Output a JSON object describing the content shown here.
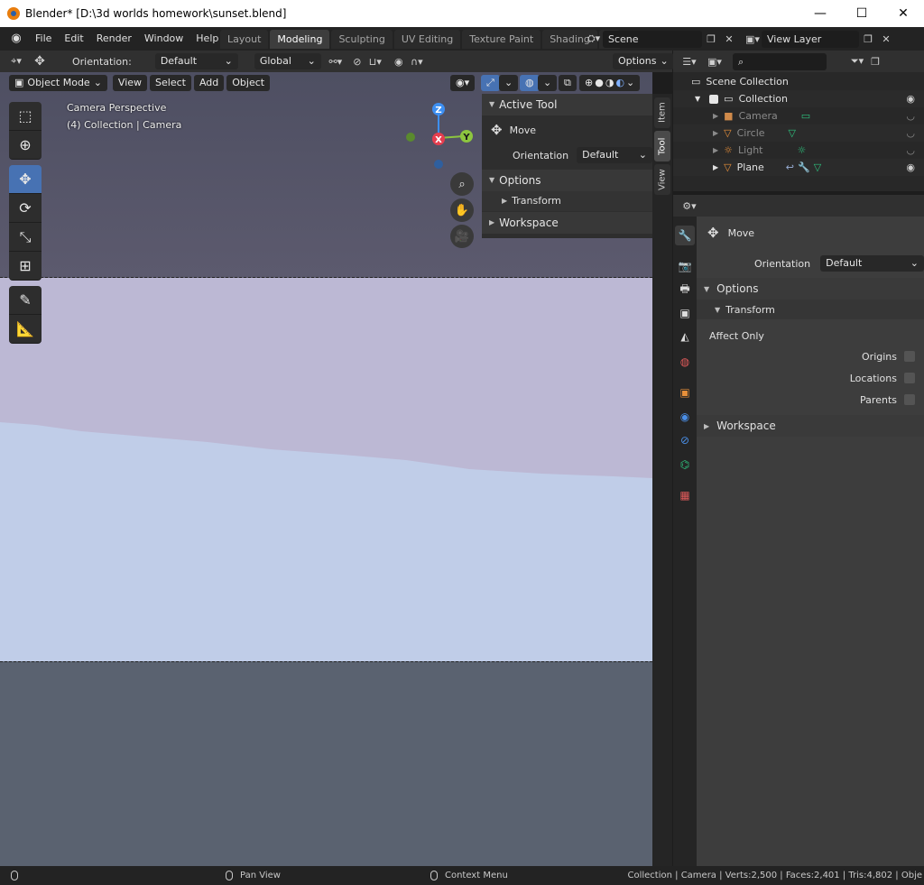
{
  "window": {
    "title": "Blender* [D:\\3d worlds homework\\sunset.blend]"
  },
  "menu": [
    "File",
    "Edit",
    "Render",
    "Window",
    "Help"
  ],
  "workspaces": [
    {
      "label": "Layout",
      "active": false
    },
    {
      "label": "Modeling",
      "active": true
    },
    {
      "label": "Sculpting",
      "active": false
    },
    {
      "label": "UV Editing",
      "active": false
    },
    {
      "label": "Texture Paint",
      "active": false
    },
    {
      "label": "Shading",
      "active": false
    },
    {
      "label": "A",
      "active": false
    }
  ],
  "scene": {
    "name": "Scene",
    "view_layer": "View Layer"
  },
  "viewport_header": {
    "orientation_label": "Orientation:",
    "orientation_value": "Default",
    "transform_space": "Global",
    "options_label": "Options",
    "mode": "Object Mode",
    "menus": [
      "View",
      "Select",
      "Add",
      "Object"
    ]
  },
  "viewport": {
    "line1": "Camera Perspective",
    "line2": "(4) Collection | Camera",
    "gizmo": {
      "z": "Z",
      "x": "X",
      "y": "Y"
    }
  },
  "npanel": {
    "active_tool_title": "Active Tool",
    "tool_name": "Move",
    "orientation_label": "Orientation",
    "orientation_value": "Default",
    "options_title": "Options",
    "transform_title": "Transform",
    "workspace_title": "Workspace",
    "tabs": [
      "Item",
      "Tool",
      "View"
    ]
  },
  "outliner": {
    "root": "Scene Collection",
    "collection": "Collection",
    "items": [
      {
        "name": "Camera",
        "color": "#d08a4a"
      },
      {
        "name": "Circle",
        "color": "#2ec27e"
      },
      {
        "name": "Light",
        "color": "#2ec27e"
      },
      {
        "name": "Plane",
        "color": "#e8903a"
      }
    ]
  },
  "properties": {
    "tool_name": "Move",
    "orientation_label": "Orientation",
    "orientation_value": "Default",
    "options_title": "Options",
    "transform_title": "Transform",
    "affect_only": "Affect Only",
    "origins": "Origins",
    "locations": "Locations",
    "parents": "Parents",
    "workspace_title": "Workspace"
  },
  "status": {
    "pan_view": "Pan View",
    "context_menu": "Context Menu",
    "stats": "Collection | Camera | Verts:2,500 | Faces:2,401 | Tris:4,802 | Obje"
  },
  "colors": {
    "accent": "#4772b3",
    "x_axis": "#e53e4f",
    "y_axis": "#8dc63f",
    "z_axis": "#3d8ff2"
  }
}
